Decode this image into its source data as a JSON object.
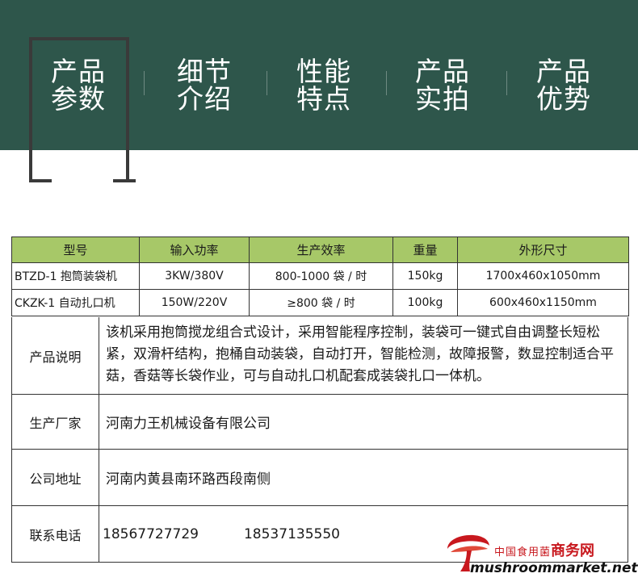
{
  "nav": {
    "items": [
      {
        "line1": "产品",
        "line2": "参数"
      },
      {
        "line1": "细节",
        "line2": "介绍"
      },
      {
        "line1": "性能",
        "line2": "特点"
      },
      {
        "line1": "产品",
        "line2": "实拍"
      },
      {
        "line1": "产品",
        "line2": "优势"
      }
    ],
    "active_index": 0
  },
  "spec_table": {
    "headers": [
      "型号",
      "输入功率",
      "生产效率",
      "重量",
      "外形尺寸"
    ],
    "rows": [
      [
        "BTZD-1 抱筒装袋机",
        "3KW/380V",
        "800-1000 袋 / 时",
        "150kg",
        "1700x460x1050mm"
      ],
      [
        "CKZK-1 自动扎口机",
        "150W/220V",
        "≥800 袋 / 时",
        "100kg",
        "600x460x1150mm"
      ]
    ],
    "header_color": "#a7c868"
  },
  "info": {
    "description_label": "产品说明",
    "description": "该机采用抱筒搅龙组合式设计，采用智能程序控制，装袋可一键式自由调整长短松紧，双滑杆结构，抱桶自动装袋，自动打开，智能检测，故障报警，数显控制适合平菇，香菇等长袋作业，可与自动扎口机配套成装袋扎口一体机。",
    "manufacturer_label": "生产厂家",
    "manufacturer": "河南力王机械设备有限公司",
    "address_label": "公司地址",
    "address": "河南内黄县南环路西段南侧",
    "phone_label": "联系电话",
    "phone1": "18567727729",
    "phone2": "18537135550"
  },
  "watermark": {
    "cn_small": "中国食用菌",
    "cn_big": "商务网",
    "en": "mushroommarket.net"
  },
  "colors": {
    "header_bg": "#2e564b",
    "table_header": "#a7c868",
    "watermark_red": "#c8181e"
  }
}
